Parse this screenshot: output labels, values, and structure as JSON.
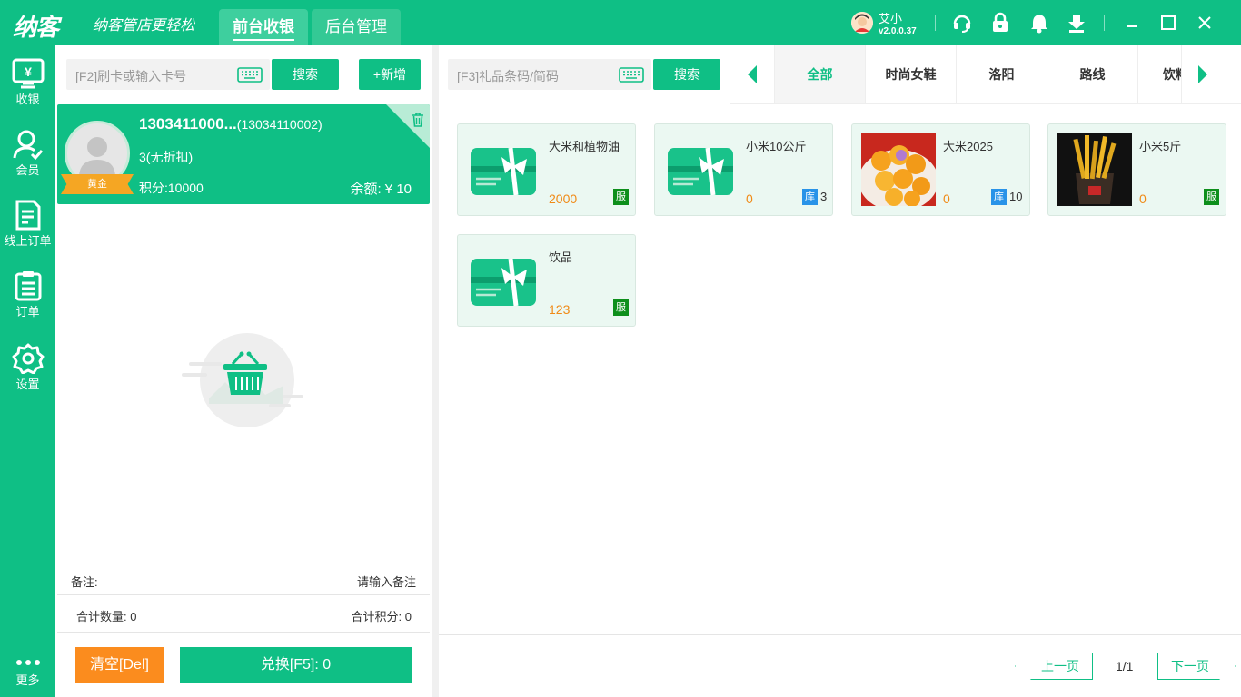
{
  "app": {
    "logo": "纳客",
    "slogan": "纳客管店更轻松",
    "tabs": [
      {
        "label": "前台收银",
        "active": true
      },
      {
        "label": "后台管理",
        "active": false
      }
    ],
    "user": {
      "name": "艾小",
      "version": "v2.0.0.37"
    },
    "accent_color": "#0fbf85",
    "top_icons": [
      "headset-icon",
      "lock-icon",
      "bell-icon",
      "download-icon"
    ],
    "window_controls": [
      "minimize-icon",
      "maximize-icon",
      "close-icon"
    ]
  },
  "nav": [
    {
      "label": "收银",
      "icon": "register-icon"
    },
    {
      "label": "会员",
      "icon": "member-icon"
    },
    {
      "label": "线上订单",
      "icon": "online-order-icon"
    },
    {
      "label": "订单",
      "icon": "order-icon"
    },
    {
      "label": "设置",
      "icon": "gear-icon"
    },
    {
      "label": "更多",
      "icon": "more-icon"
    }
  ],
  "member_search": {
    "placeholder": "[F2]刷卡或输入卡号",
    "search_label": "搜索",
    "add_label": "+新增"
  },
  "member": {
    "name": "1303411000...",
    "card_no": "(13034110002)",
    "level": "3(无折扣)",
    "badge": "黄金",
    "points": "积分:10000",
    "balance": "余额: ¥ 10"
  },
  "cart": {
    "remark_label": "备注:",
    "remark_placeholder": "请输入备注",
    "total_qty": "合计数量:  0",
    "total_points": "合计积分:  0",
    "clear_label": "清空[Del]",
    "exchange_label": "兑换[F5]:  0"
  },
  "product_search": {
    "placeholder": "[F3]礼品条码/简码",
    "search_label": "搜索"
  },
  "categories": [
    {
      "label": "全部",
      "active": true
    },
    {
      "label": "时尚女鞋",
      "active": false
    },
    {
      "label": "洛阳",
      "active": false
    },
    {
      "label": "路线",
      "active": false
    },
    {
      "label": "饮料",
      "active": false
    }
  ],
  "products": [
    {
      "name": "大米和植物油",
      "price": "2000",
      "tag": "服",
      "stock": null,
      "image": "gift-card"
    },
    {
      "name": "小米10公斤",
      "price": "0",
      "tag": "库",
      "stock": "3",
      "image": "gift-card"
    },
    {
      "name": "大米2025",
      "price": "0",
      "tag": "库",
      "stock": "10",
      "image": "photo-rice-balls"
    },
    {
      "name": "小米5斤",
      "price": "0",
      "tag": "服",
      "stock": null,
      "image": "photo-fries"
    },
    {
      "name": "饮品",
      "price": "123",
      "tag": "服",
      "stock": null,
      "image": "gift-card"
    }
  ],
  "pager": {
    "prev_label": "上一页",
    "next_label": "下一页",
    "page_info": "1/1"
  }
}
